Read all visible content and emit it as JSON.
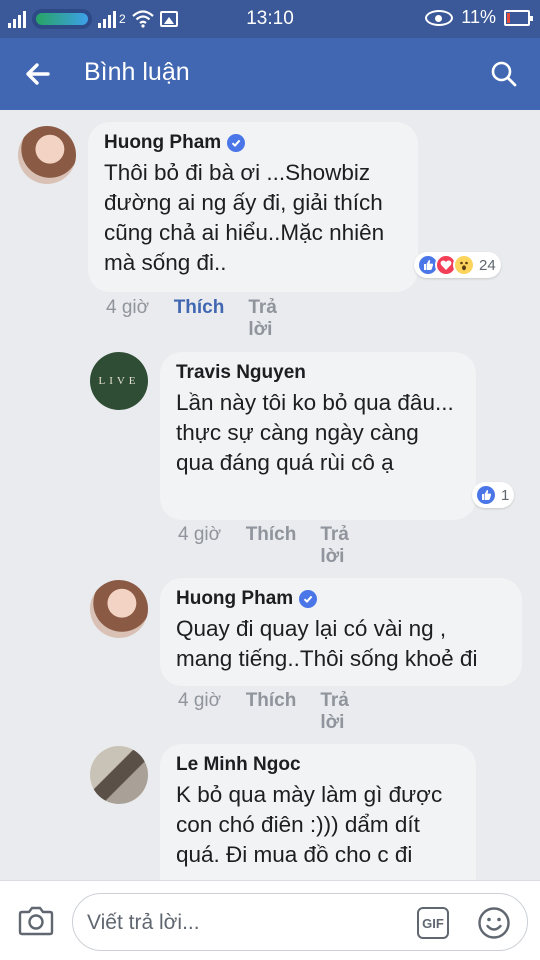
{
  "status_bar": {
    "time": "13:10",
    "battery": "11%",
    "sim2": "2"
  },
  "app_bar": {
    "title": "Bình luận"
  },
  "comments": [
    {
      "author": "Huong Pham",
      "verified": true,
      "text": "Thôi bỏ đi bà ơi ...Showbiz đường ai ng ấy đi, giải thích cũng chả ai hiểu..Mặc nhiên mà sống đi..",
      "time": "4 giờ",
      "like_label": "Thích",
      "reply_label": "Trả lời",
      "reactions": [
        "like",
        "love",
        "wow"
      ],
      "reaction_count": "24",
      "liked": true
    },
    {
      "author": "Travis Nguyen",
      "verified": false,
      "avatar_text": "LIVE",
      "text": "Lần này tôi ko bỏ qua đâu... thực sự càng ngày càng qua đáng quá rùi cô ạ",
      "time": "4 giờ",
      "like_label": "Thích",
      "reply_label": "Trả lời",
      "reactions": [
        "like"
      ],
      "reaction_count": "1",
      "liked": false
    },
    {
      "author": "Huong Pham",
      "verified": true,
      "text": "Quay đi quay lại có vài ng , mang tiếng..Thôi sống khoẻ đi",
      "time": "4 giờ",
      "like_label": "Thích",
      "reply_label": "Trả lời",
      "liked": false
    },
    {
      "author": "Le Minh Ngoc",
      "verified": false,
      "text": "K bỏ qua mày làm gì được con chó điên :))) dẩm dít quá. Đi mua đồ cho c đi",
      "liked": false
    }
  ],
  "composer": {
    "placeholder": "Viết trả lời...",
    "gif_label": "GIF"
  },
  "icons": [
    "back-arrow-icon",
    "search-icon",
    "verified-icon",
    "camera-icon",
    "gif-icon",
    "emoji-icon",
    "wifi-icon",
    "eye-icon",
    "battery-icon",
    "image-icon"
  ],
  "colors": {
    "status_bar": "#3b5998",
    "app_bar": "#4267b2",
    "background": "#e9ebee",
    "bubble": "#f2f3f5",
    "link_active": "#4267b2",
    "muted": "#90949c"
  }
}
